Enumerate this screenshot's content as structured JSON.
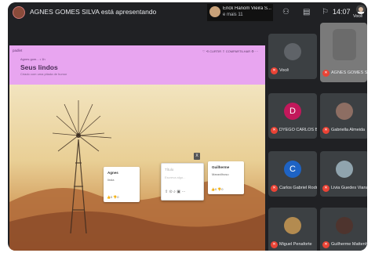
{
  "topbar": {
    "presenting_text": "AGNES GOMES SILVA está apresentando",
    "presenter_initial": "",
    "join_name": "Erick Hanom Vieira S...",
    "join_more": "e mais 11",
    "clock": "14:07",
    "you_label": "Você"
  },
  "shared_screen": {
    "app_logo": "padlet",
    "actions": "♡  ⟲ CURTIR  ⇪ COMPARTILHAR  ⚙  ···",
    "author": "Agnes gom... • 1h",
    "title": "Seus lindos",
    "subtitle": "Criado com uma pitada de humor",
    "cards": [
      {
        "title": "Agnes",
        "body": "linda",
        "footer": "👍0  👎0"
      },
      {
        "title": "Guilherme",
        "body": "Maravilhoso",
        "footer": "👍0  👎0"
      }
    ],
    "input_card": {
      "title_placeholder": "Título",
      "body_placeholder": "Escreva algo...",
      "tools": "⇪  ⊙  ⌕  ▣  ···"
    },
    "close_label": "X"
  },
  "participants": [
    {
      "name": "Você",
      "initial": "",
      "color": "#5f6368"
    },
    {
      "name": "AGNES GOMES SILVA",
      "initial": "",
      "color": "#6b6b6b"
    },
    {
      "name": "DYEGO CARLOS BATI...",
      "initial": "D",
      "color": "#c2185b"
    },
    {
      "name": "Gabriella Almeida",
      "initial": "",
      "color": "#8d6e63"
    },
    {
      "name": "Carlos Gabriel Rodrig...",
      "initial": "C",
      "color": "#1e63c4"
    },
    {
      "name": "Livia Guedes Viana",
      "initial": "",
      "color": "#90a4ae"
    },
    {
      "name": "Miguel Penaforte",
      "initial": "",
      "color": "#b38b50"
    },
    {
      "name": "Guilherme Mattenhe...",
      "initial": "",
      "color": "#4e342e"
    }
  ],
  "colors": {
    "background": "#202124",
    "tile": "#3c4043",
    "mic_muted": "#ea4335",
    "padlet_header": "#e8a5f0"
  }
}
